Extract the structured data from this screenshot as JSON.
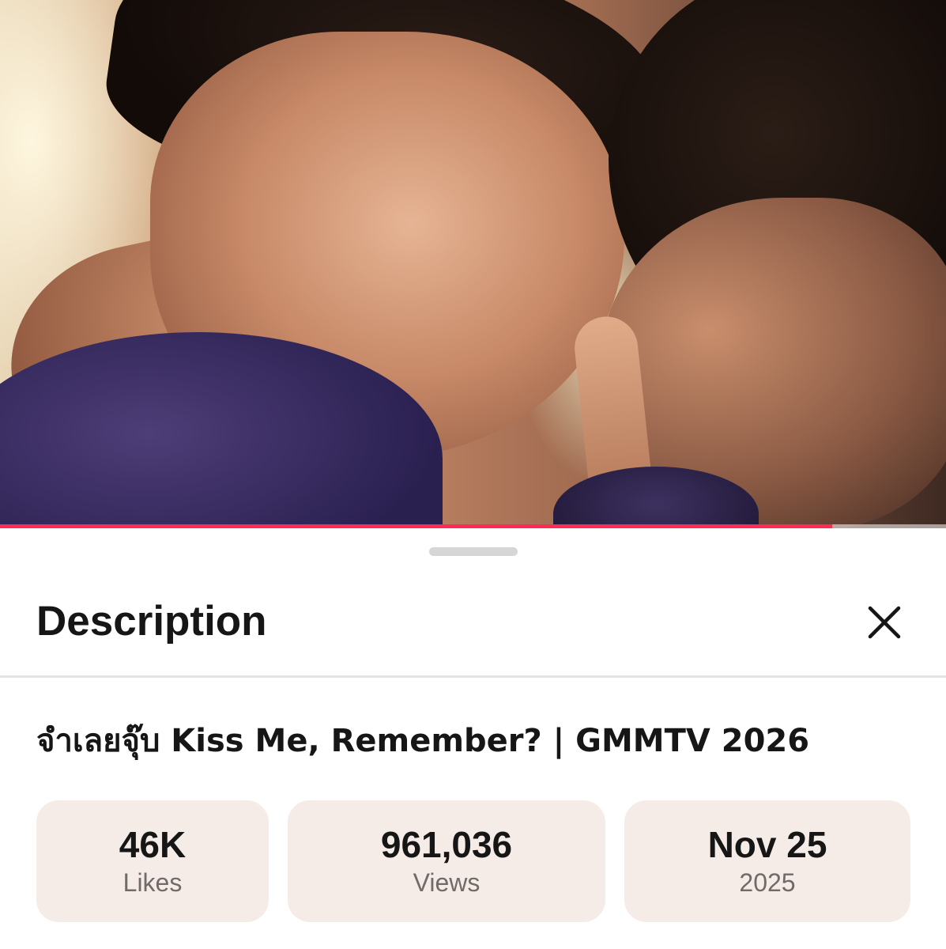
{
  "video": {
    "progress_fraction": 0.88,
    "accent_color": "#fe2c55"
  },
  "sheet": {
    "title": "Description",
    "close_icon": "close-icon"
  },
  "description": {
    "video_title": "จำเลยจุ๊บ Kiss Me, Remember? | GMMTV 2026"
  },
  "stats": {
    "likes_value": "46K",
    "likes_label": "Likes",
    "views_value": "961,036",
    "views_label": "Views",
    "date_value": "Nov 25",
    "date_year": "2025"
  },
  "colors": {
    "card_background": "#f6ece7",
    "text_primary": "#161616",
    "text_secondary": "#6f6b69"
  }
}
